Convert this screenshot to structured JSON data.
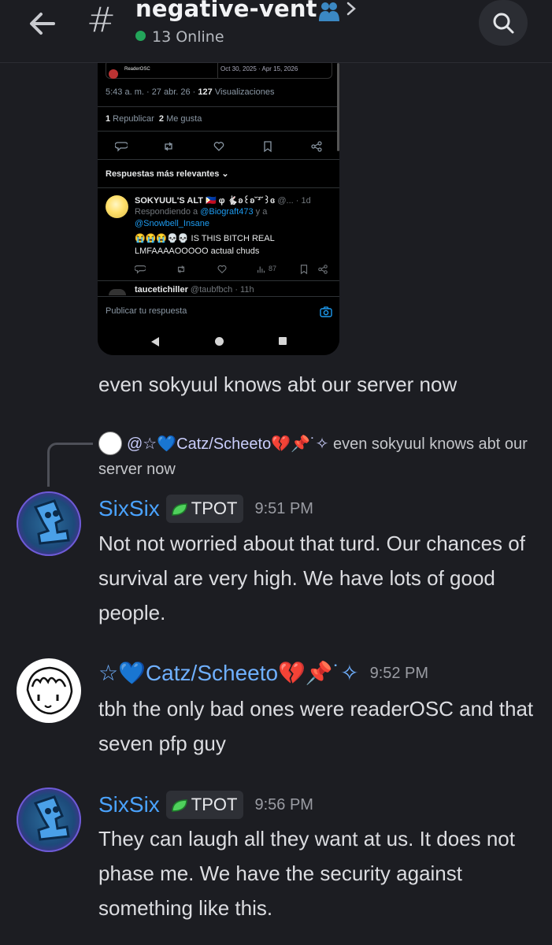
{
  "header": {
    "channel_name": "negative-vent",
    "channel_emoji": "people-hugging-icon",
    "online": "13 Online",
    "accent_online": "#23a55a"
  },
  "embedded_screenshot": {
    "quote_name": "ReaderOSC",
    "quote_date_info": "Oct 30, 2025 · Apr 15, 2026",
    "meta_prefix": "5:43 a. m. · 27 abr. 26 · ",
    "meta_views": "127",
    "meta_views_label": " Visualizaciones",
    "reposts_count": "1",
    "reposts_label": " Republicar",
    "likes_count": "2",
    "likes_label": " Me gusta",
    "relevant_label": "Respuestas más relevantes",
    "reply_name": "SOKYUUL'S ALT",
    "reply_name_deco": "🇵🇭 φ 🐇ʚ꒰ʚ˘³˘꒱ɞ",
    "reply_handle": "@... · 1d",
    "replying_to_prefix": "Respondiendo a ",
    "replying_to_1": "@Biograft473",
    "replying_to_mid": " y a",
    "replying_to_2": "@Snowbell_Insane",
    "reply_text_1": "😭😭😭💀💀 IS THIS BITCH REAL",
    "reply_text_2": "LMFAAAAOOOOO actual chuds",
    "reply_views": "87",
    "next_name": "taucetichiller",
    "next_handle": " @taubfbch · 11h",
    "reply_placeholder": "Publicar tu respuesta"
  },
  "messages": {
    "m1_text": "even sokyuul knows abt our server now",
    "reply_ref_mention": "@☆💙Catz/Scheeto💔📌˙✧",
    "reply_ref_text": " even sokyuul knows abt our server now",
    "m2_author": "SixSix",
    "m2_tag": "TPOT",
    "m2_time": "9:51 PM",
    "m2_text": "Not not worried about that turd. Our chances of survival are very high. We have lots of good people.",
    "m3_author": "☆💙Catz/Scheeto💔📌˙✧",
    "m3_time": "9:52 PM",
    "m3_text": "tbh the only bad ones were readerOSC and that seven pfp guy",
    "m4_author": "SixSix",
    "m4_tag": "TPOT",
    "m4_time": "9:56 PM",
    "m4_text": "They can laugh all they want at us. It does not phase me. We have the security against something like this."
  }
}
